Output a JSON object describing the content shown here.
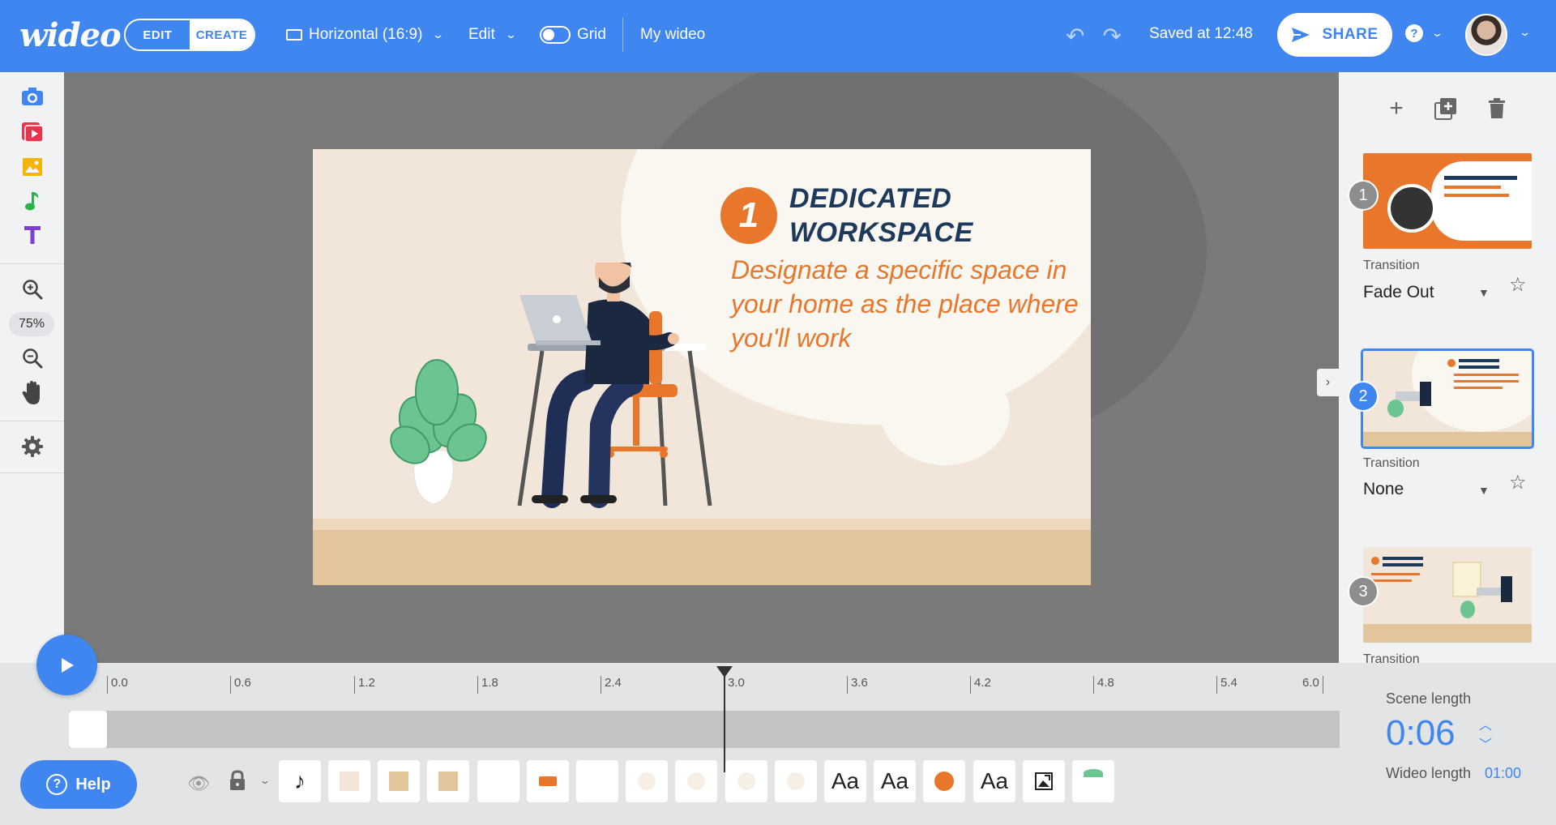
{
  "topbar": {
    "logo": "wideo",
    "mode_edit": "EDIT",
    "mode_create": "CREATE",
    "format": "Horizontal (16:9)",
    "edit_menu": "Edit",
    "grid_label": "Grid",
    "project_name": "My wideo",
    "saved_status": "Saved at 12:48",
    "share_label": "SHARE",
    "help_glyph": "?"
  },
  "left_tools": {
    "zoom_level": "75%",
    "icons": [
      "camera-icon",
      "video-icon",
      "image-icon",
      "music-icon",
      "text-icon",
      "zoom-in-icon",
      "zoom-out-icon",
      "hand-icon",
      "gear-icon"
    ]
  },
  "slide": {
    "number": "1",
    "title_line1": "DEDICATED",
    "title_line2": "WORKSPACE",
    "body": "Designate a specific space in your home as the place where you'll work",
    "colors": {
      "accent": "#e8762b",
      "title": "#1d3a5c",
      "background": "#f2e6da",
      "floor": "#e2c59b"
    }
  },
  "scenes": {
    "items": [
      {
        "number": "1",
        "transition_label": "Transition",
        "transition": "Fade Out"
      },
      {
        "number": "2",
        "transition_label": "Transition",
        "transition": "None"
      },
      {
        "number": "3",
        "transition_label": "Transition",
        "transition": ""
      }
    ]
  },
  "timeline": {
    "ticks": [
      "0.0",
      "0.6",
      "1.2",
      "1.8",
      "2.4",
      "3.0",
      "3.6",
      "4.2",
      "4.8",
      "5.4",
      "6.0"
    ],
    "help_label": "Help",
    "scene_length_label": "Scene length",
    "scene_length": "0:06",
    "wideo_length_label": "Wideo length",
    "wideo_length": "01:00",
    "elements": [
      "♪",
      "",
      "",
      "",
      "",
      "",
      "",
      "",
      "",
      "",
      "",
      "Aa",
      "Aa",
      "",
      "Aa",
      "",
      ""
    ]
  },
  "accent_color": "#3f86f0"
}
